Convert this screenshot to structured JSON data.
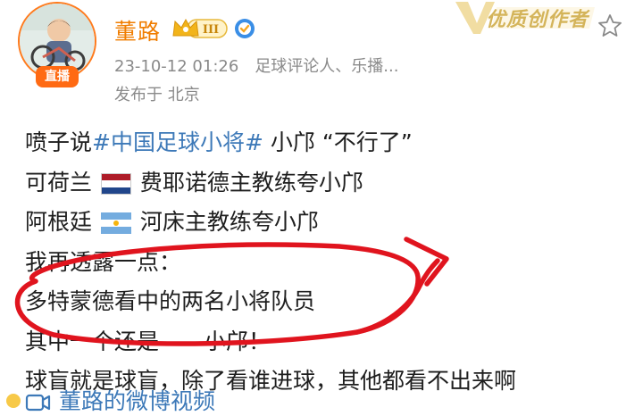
{
  "post": {
    "author": {
      "name": "董路",
      "live_badge": "直播",
      "vip_level": "III"
    },
    "creator_badge": "优质创作者",
    "meta": {
      "timestamp": "23-10-12 01:26",
      "tags": "足球评论人、乐播..."
    },
    "location": "发布于 北京",
    "content": {
      "line1_prefix": "喷子说",
      "line1_hashtag": "#中国足球小将#",
      "line1_suffix": " 小邝 “不行了”",
      "line2_prefix": "可荷兰",
      "line2_suffix": "费耶诺德主教练夸小邝",
      "line3_prefix": "阿根廷",
      "line3_suffix": "河床主教练夸小邝",
      "line4": "我再透露一点：",
      "line5": "多特蒙德看中的两名小将队员",
      "line6": "其中一个还是——小邝！",
      "line7": "球盲就是球盲，除了看谁进球，其他都看不出来啊"
    },
    "video_link": "董路的微博视频"
  },
  "colors": {
    "username": "#f07d00",
    "hashtag": "#3d79b8",
    "annotation": "#e0141e",
    "live_badge": "#ff6a13"
  },
  "icons": {
    "flag_1": "netherlands-flag-icon",
    "flag_2": "argentina-flag-icon",
    "video": "video-camera-icon",
    "verify": "verified-icon",
    "favorite": "star-icon"
  }
}
